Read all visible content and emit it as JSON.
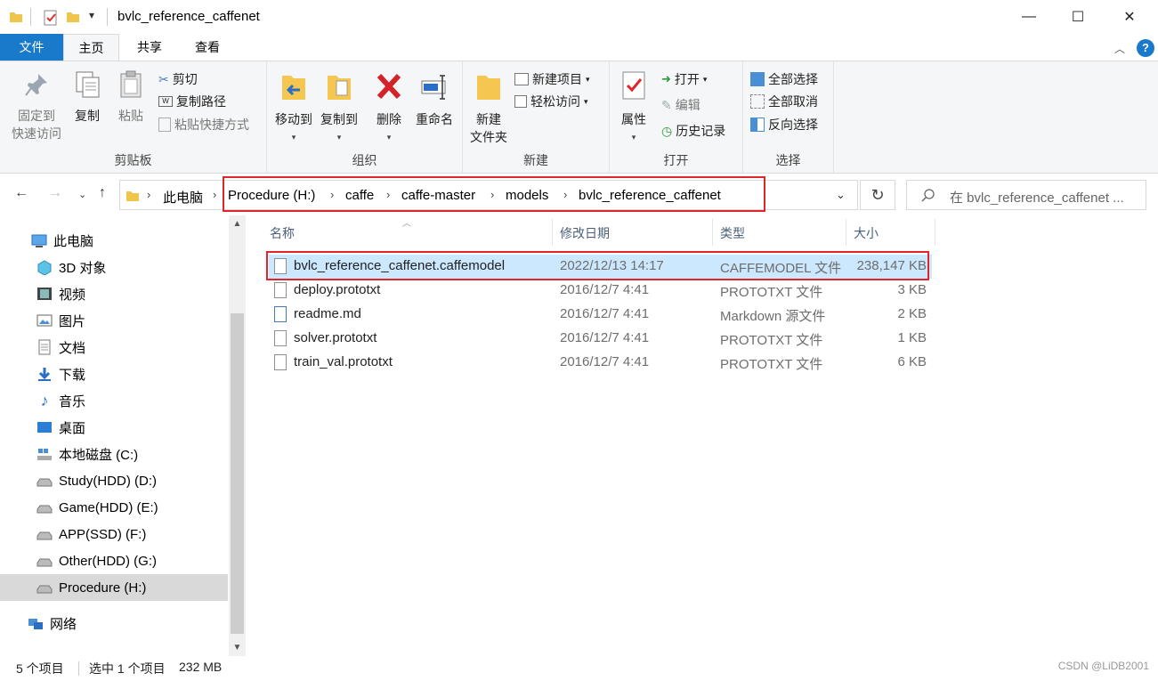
{
  "window": {
    "title": "bvlc_reference_caffenet",
    "minimize": "—",
    "maximize": "☐",
    "close": "✕"
  },
  "tabs": [
    "文件",
    "主页",
    "共享",
    "查看"
  ],
  "ribbon": {
    "clipboard": {
      "pin_line1": "固定到",
      "pin_line2": "快速访问",
      "copy": "复制",
      "paste": "粘贴",
      "cut": "剪切",
      "copy_path": "复制路径",
      "paste_shortcut": "粘贴快捷方式",
      "label": "剪贴板"
    },
    "organize": {
      "move_to": "移动到",
      "copy_to": "复制到",
      "delete": "删除",
      "rename": "重命名",
      "label": "组织"
    },
    "new": {
      "new_folder_line1": "新建",
      "new_folder_line2": "文件夹",
      "new_item": "新建项目",
      "easy_access": "轻松访问",
      "label": "新建"
    },
    "open": {
      "properties": "属性",
      "open": "打开",
      "edit": "编辑",
      "history": "历史记录",
      "label": "打开"
    },
    "select": {
      "select_all": "全部选择",
      "select_none": "全部取消",
      "invert": "反向选择",
      "label": "选择"
    }
  },
  "address": {
    "root": "此电脑",
    "crumbs": [
      "Procedure (H:)",
      "caffe",
      "caffe-master",
      "models",
      "bvlc_reference_caffenet"
    ],
    "search_placeholder": "在 bvlc_reference_caffenet ..."
  },
  "nav": {
    "items": [
      {
        "label": "此电脑",
        "icon": "pc-icon"
      },
      {
        "label": "3D 对象",
        "icon": "3d-objects-icon"
      },
      {
        "label": "视频",
        "icon": "video-icon"
      },
      {
        "label": "图片",
        "icon": "pictures-icon"
      },
      {
        "label": "文档",
        "icon": "documents-icon"
      },
      {
        "label": "下载",
        "icon": "download-icon"
      },
      {
        "label": "音乐",
        "icon": "music-icon"
      },
      {
        "label": "桌面",
        "icon": "desktop-icon"
      },
      {
        "label": "本地磁盘 (C:)",
        "icon": "system-drive-icon"
      },
      {
        "label": "Study(HDD) (D:)",
        "icon": "drive-icon"
      },
      {
        "label": "Game(HDD) (E:)",
        "icon": "drive-icon"
      },
      {
        "label": "APP(SSD) (F:)",
        "icon": "drive-icon"
      },
      {
        "label": "Other(HDD) (G:)",
        "icon": "drive-icon"
      },
      {
        "label": "Procedure (H:)",
        "icon": "drive-icon",
        "selected": true
      },
      {
        "label": "网络",
        "icon": "network-icon"
      }
    ]
  },
  "columns": [
    "名称",
    "修改日期",
    "类型",
    "大小"
  ],
  "files": [
    {
      "name": "bvlc_reference_caffenet.caffemodel",
      "date": "2022/12/13 14:17",
      "type": "CAFFEMODEL 文件",
      "size": "238,147 KB",
      "selected": true
    },
    {
      "name": "deploy.prototxt",
      "date": "2016/12/7 4:41",
      "type": "PROTOTXT 文件",
      "size": "3 KB"
    },
    {
      "name": "readme.md",
      "date": "2016/12/7 4:41",
      "type": "Markdown 源文件",
      "size": "2 KB"
    },
    {
      "name": "solver.prototxt",
      "date": "2016/12/7 4:41",
      "type": "PROTOTXT 文件",
      "size": "1 KB"
    },
    {
      "name": "train_val.prototxt",
      "date": "2016/12/7 4:41",
      "type": "PROTOTXT 文件",
      "size": "6 KB"
    }
  ],
  "status": {
    "count": "5 个项目",
    "selection": "选中 1 个项目",
    "size": "232 MB",
    "watermark": "CSDN @LiDB2001"
  },
  "colors": {
    "accent": "#1979ca",
    "selection": "#cce8ff",
    "highlight_box": "#e0262b"
  }
}
